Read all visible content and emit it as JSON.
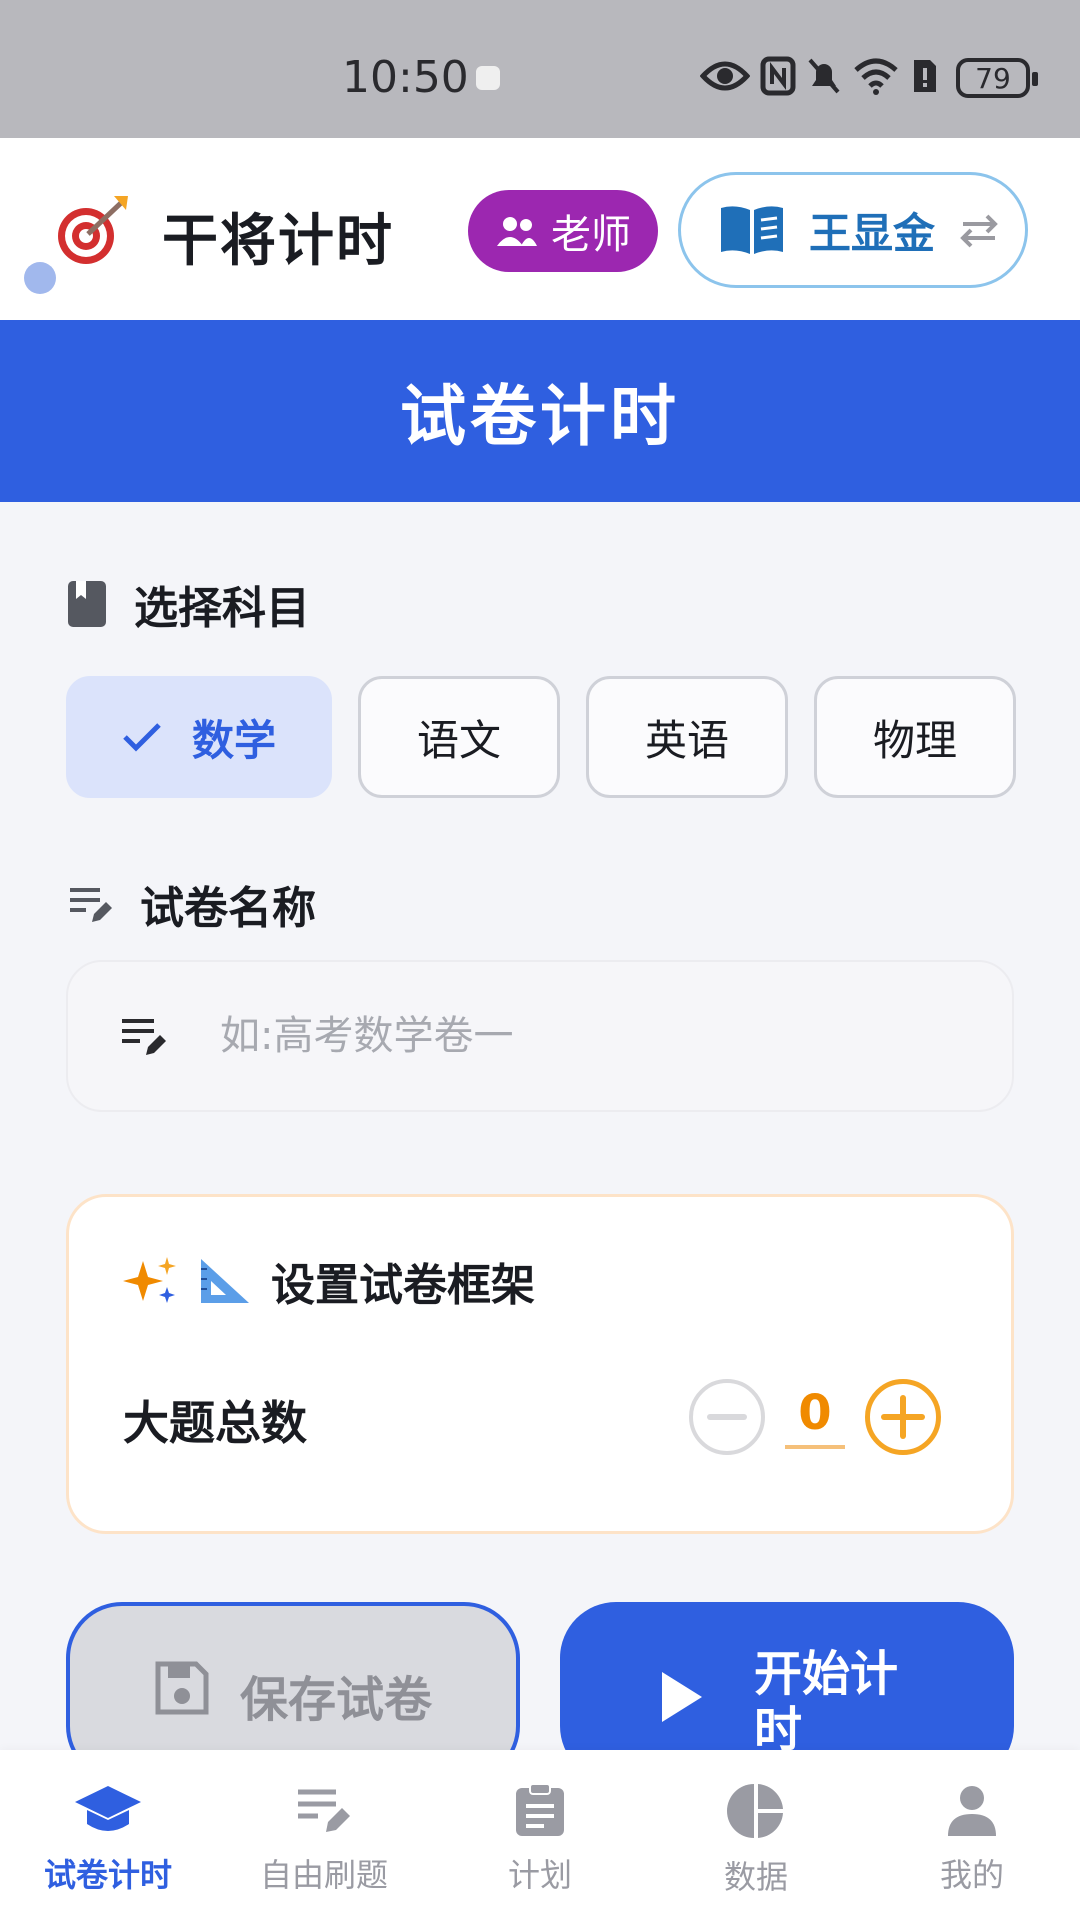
{
  "status_bar": {
    "time": "10:50",
    "battery": "79"
  },
  "header": {
    "app_title": "干将计时",
    "role_label": "老师",
    "student_name": "王显金"
  },
  "banner": {
    "title": "试卷计时"
  },
  "subject_section": {
    "label": "选择科目",
    "subjects": [
      {
        "label": "数学",
        "selected": true
      },
      {
        "label": "语文",
        "selected": false
      },
      {
        "label": "英语",
        "selected": false
      },
      {
        "label": "物理",
        "selected": false
      }
    ]
  },
  "paper_name_section": {
    "label": "试卷名称",
    "placeholder": "如:高考数学卷一",
    "value": ""
  },
  "framework": {
    "title": "设置试卷框架",
    "row_label": "大题总数",
    "count": "0"
  },
  "actions": {
    "save_label": "保存试卷",
    "start_label": "开始计时"
  },
  "bottom_nav": [
    {
      "label": "试卷计时",
      "icon": "graduation-cap-icon",
      "active": true
    },
    {
      "label": "自由刷题",
      "icon": "edit-notes-icon",
      "active": false
    },
    {
      "label": "计划",
      "icon": "clipboard-icon",
      "active": false
    },
    {
      "label": "数据",
      "icon": "pie-chart-icon",
      "active": false
    },
    {
      "label": "我的",
      "icon": "person-icon",
      "active": false
    }
  ],
  "colors": {
    "primary": "#2f5fe0",
    "role_badge": "#9c27b0",
    "accent_orange": "#f5a524"
  }
}
